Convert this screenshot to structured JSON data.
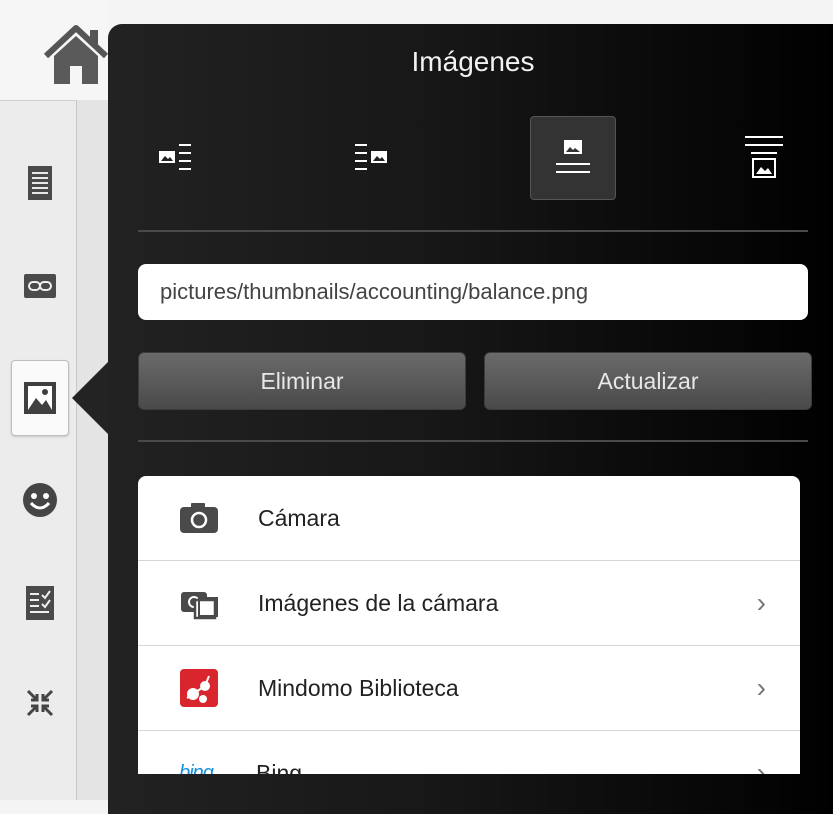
{
  "panel": {
    "title": "Imágenes",
    "path_value": "pictures/thumbnails/accounting/balance.png",
    "delete_label": "Eliminar",
    "update_label": "Actualizar"
  },
  "alignment": [
    {
      "icon": "align-image-left-icon",
      "active": false
    },
    {
      "icon": "align-image-right-icon",
      "active": false
    },
    {
      "icon": "align-image-center-icon",
      "active": true
    },
    {
      "icon": "align-image-below-icon",
      "active": false
    }
  ],
  "sources": [
    {
      "label": "Cámara",
      "icon": "camera-icon",
      "chevron": false
    },
    {
      "label": "Imágenes de la cámara",
      "icon": "gallery-icon",
      "chevron": true
    },
    {
      "label": "Mindomo Biblioteca",
      "icon": "mindomo-icon",
      "chevron": true
    },
    {
      "label": "Bing",
      "icon": "bing-logo",
      "chevron": true
    }
  ],
  "bing_logo_text": "bing",
  "toolbar": {
    "items": [
      "home-icon",
      "notes-icon",
      "link-icon",
      "image-icon",
      "smiley-icon",
      "checklist-icon",
      "collapse-icon"
    ],
    "selected": "image-icon"
  },
  "colors": {
    "panel_bg": "#000000",
    "mindomo_red": "#d9252e",
    "bing_blue": "#1a8fd6"
  }
}
